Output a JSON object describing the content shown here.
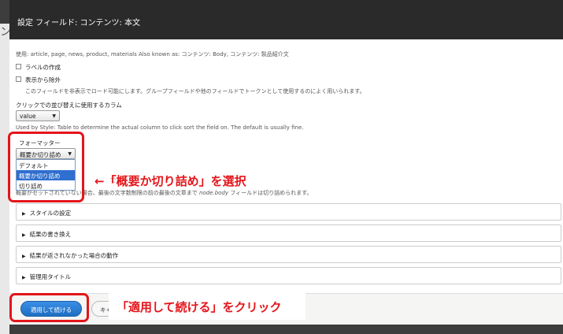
{
  "dialog": {
    "title": "設定 フィールド: コンテンツ: 本文"
  },
  "form": {
    "usage_text": "使用: article, page, news, product, materials Also known as: コンテンツ: Body, コンテンツ: 製品紹介文",
    "create_label_text": "ラベルの作成",
    "exclude_text": "表示から除外",
    "exclude_desc": "このフィールドを非表示でロード可能にします。グループフィールドや他のフィールドでトークンとして使用するのによく用いられます。",
    "click_sort_label": "クリックでの並び替えに使用するカラム",
    "click_sort_value": "value",
    "used_by_style": "Used by Style: Table to determine the actual column to click sort the field on. The default is usually fine.",
    "formatter_label": "フォーマッター",
    "formatter_value": "概要か切り詰め",
    "formatter_options": [
      "デフォルト",
      "概要か切り詰め",
      "切り詰め"
    ],
    "hidden_partial": "で",
    "summary_desc_a": "概要がセットされていない場合、最後の文字数制限の前の最後の文章まで ",
    "summary_desc_em": "node.body",
    "summary_desc_b": " フィールドは切り詰められます。"
  },
  "sections": [
    {
      "label": "スタイルの設定"
    },
    {
      "label": "結果の書き換え"
    },
    {
      "label": "結果が返されなかった場合の動作"
    },
    {
      "label": "管理用タイトル"
    }
  ],
  "footer": {
    "apply_label": "適用して続ける",
    "cancel_label": "キャンセル"
  },
  "annotations": {
    "select_note": "←「概要か切り詰め」を選択",
    "apply_note": "「適用して続ける」をクリック"
  },
  "background": {
    "peek_text": "ン"
  },
  "colors": {
    "annotation_red": "#e3151a",
    "primary_blue": "#2f6fcf",
    "titlebar": "#2a2a2a"
  }
}
